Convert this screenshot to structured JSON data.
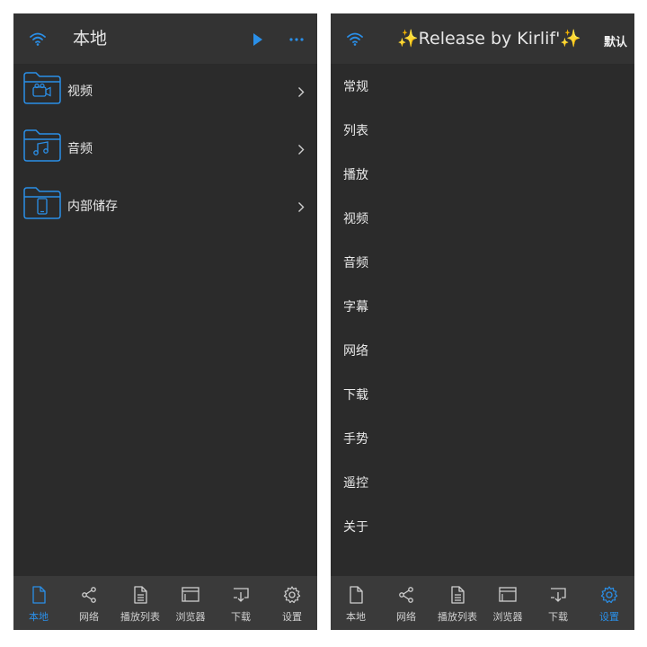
{
  "colors": {
    "accent": "#2a8fe8",
    "background": "#2b2b2b",
    "header": "#333333",
    "tabbar": "#3a3a3a",
    "text": "#e8e8e8"
  },
  "left": {
    "header": {
      "title": "本地",
      "left_icon": "wifi-icon",
      "right_icons": [
        "play-icon",
        "more-icon"
      ]
    },
    "items": [
      {
        "label": "视频",
        "icon": "video-folder-icon"
      },
      {
        "label": "音频",
        "icon": "music-folder-icon"
      },
      {
        "label": "内部储存",
        "icon": "phone-folder-icon"
      }
    ],
    "active_tab": "本地"
  },
  "right": {
    "header": {
      "title": "✨Release by Kirlif'✨",
      "action": "默认",
      "left_icon": "wifi-icon"
    },
    "items": [
      "常规",
      "列表",
      "播放",
      "视频",
      "音频",
      "字幕",
      "网络",
      "下载",
      "手势",
      "遥控",
      "关于"
    ],
    "active_tab": "设置"
  },
  "tabs": [
    {
      "label": "本地",
      "icon": "file-icon"
    },
    {
      "label": "网络",
      "icon": "share-icon"
    },
    {
      "label": "播放列表",
      "icon": "playlist-icon"
    },
    {
      "label": "浏览器",
      "icon": "browser-icon"
    },
    {
      "label": "下载",
      "icon": "download-icon"
    },
    {
      "label": "设置",
      "icon": "gear-icon"
    }
  ]
}
